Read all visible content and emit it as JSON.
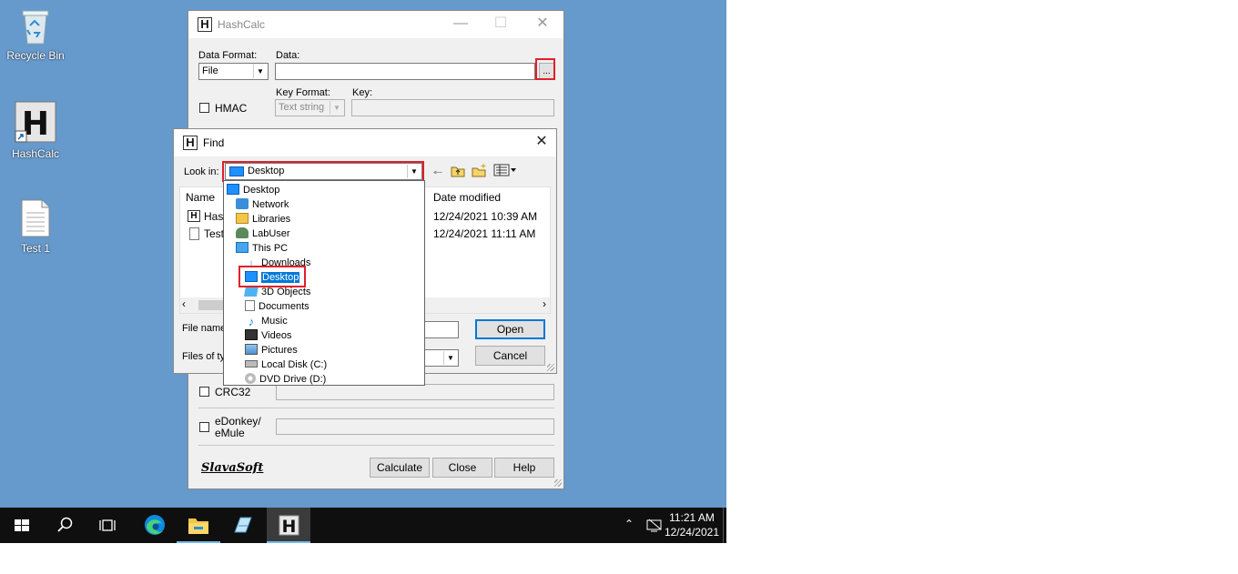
{
  "desktop": {
    "icons": [
      {
        "label": "Recycle Bin",
        "icon": "recycle-bin-icon"
      },
      {
        "label": "HashCalc",
        "icon": "hashcalc-shortcut-icon"
      },
      {
        "label": "Test 1",
        "icon": "text-file-icon"
      }
    ]
  },
  "hashcalc": {
    "title": "HashCalc",
    "data_format_label": "Data Format:",
    "data_format_value": "File",
    "data_label": "Data:",
    "data_value": "",
    "browse_label": "...",
    "hmac_label": "HMAC",
    "key_format_label": "Key Format:",
    "key_format_value": "Text string",
    "key_label": "Key:",
    "crc32_label": "CRC32",
    "edonkey_label": "eDonkey/\neMule",
    "brand": "SlavaSoft",
    "calculate_label": "Calculate",
    "close_label": "Close",
    "help_label": "Help"
  },
  "find": {
    "title": "Find",
    "look_in_label": "Look in:",
    "look_in_value": "Desktop",
    "name_col": "Name",
    "date_col": "Date modified",
    "files": [
      {
        "name": "Hash",
        "date": "12/24/2021 10:39 AM"
      },
      {
        "name": "Test",
        "date": "12/24/2021 11:11 AM"
      }
    ],
    "file_name_label": "File name",
    "files_of_type_label": "Files of typ",
    "open_label": "Open",
    "cancel_label": "Cancel"
  },
  "dropdown": {
    "items": [
      {
        "label": "Desktop",
        "icon": "desktop-icon",
        "level": 0
      },
      {
        "label": "Network",
        "icon": "network-icon",
        "level": 1
      },
      {
        "label": "Libraries",
        "icon": "libraries-icon",
        "level": 1
      },
      {
        "label": "LabUser",
        "icon": "user-icon",
        "level": 1
      },
      {
        "label": "This PC",
        "icon": "this-pc-icon",
        "level": 1
      },
      {
        "label": "Downloads",
        "icon": "downloads-icon",
        "level": 2
      },
      {
        "label": "Desktop",
        "icon": "desktop-icon",
        "level": 2,
        "selected": true
      },
      {
        "label": "3D Objects",
        "icon": "3d-objects-icon",
        "level": 2
      },
      {
        "label": "Documents",
        "icon": "documents-icon",
        "level": 2
      },
      {
        "label": "Music",
        "icon": "music-icon",
        "level": 2
      },
      {
        "label": "Videos",
        "icon": "videos-icon",
        "level": 2
      },
      {
        "label": "Pictures",
        "icon": "pictures-icon",
        "level": 2
      },
      {
        "label": "Local Disk (C:)",
        "icon": "local-disk-icon",
        "level": 2
      },
      {
        "label": "DVD Drive (D:)",
        "icon": "dvd-drive-icon",
        "level": 2
      }
    ]
  },
  "taskbar": {
    "time": "11:21 AM",
    "date": "12/24/2021"
  },
  "colors": {
    "desktop_bg": "#6699cc",
    "highlight_red": "#e0202a",
    "selection_blue": "#0078d7"
  }
}
